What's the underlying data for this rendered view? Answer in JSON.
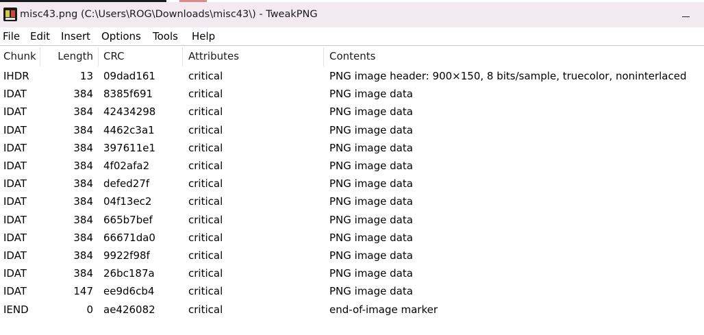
{
  "window": {
    "title": "misc43.png (C:\\Users\\ROG\\Downloads\\misc43\\) - TweakPNG"
  },
  "menu": [
    "File",
    "Edit",
    "Insert",
    "Options",
    "Tools",
    "Help"
  ],
  "columns": [
    "Chunk",
    "Length",
    "CRC",
    "Attributes",
    "Contents"
  ],
  "rows": [
    {
      "chunk": "IHDR",
      "length": "13",
      "crc": "09dad161",
      "attributes": "critical",
      "contents": "PNG image header: 900×150, 8 bits/sample, truecolor, noninterlaced"
    },
    {
      "chunk": "IDAT",
      "length": "384",
      "crc": "8385f691",
      "attributes": "critical",
      "contents": "PNG image data"
    },
    {
      "chunk": "IDAT",
      "length": "384",
      "crc": "42434298",
      "attributes": "critical",
      "contents": "PNG image data"
    },
    {
      "chunk": "IDAT",
      "length": "384",
      "crc": "4462c3a1",
      "attributes": "critical",
      "contents": "PNG image data"
    },
    {
      "chunk": "IDAT",
      "length": "384",
      "crc": "397611e1",
      "attributes": "critical",
      "contents": "PNG image data"
    },
    {
      "chunk": "IDAT",
      "length": "384",
      "crc": "4f02afa2",
      "attributes": "critical",
      "contents": "PNG image data"
    },
    {
      "chunk": "IDAT",
      "length": "384",
      "crc": "defed27f",
      "attributes": "critical",
      "contents": "PNG image data"
    },
    {
      "chunk": "IDAT",
      "length": "384",
      "crc": "04f13ec2",
      "attributes": "critical",
      "contents": "PNG image data"
    },
    {
      "chunk": "IDAT",
      "length": "384",
      "crc": "665b7bef",
      "attributes": "critical",
      "contents": "PNG image data"
    },
    {
      "chunk": "IDAT",
      "length": "384",
      "crc": "66671da0",
      "attributes": "critical",
      "contents": "PNG image data"
    },
    {
      "chunk": "IDAT",
      "length": "384",
      "crc": "9922f98f",
      "attributes": "critical",
      "contents": "PNG image data"
    },
    {
      "chunk": "IDAT",
      "length": "384",
      "crc": "26bc187a",
      "attributes": "critical",
      "contents": "PNG image data"
    },
    {
      "chunk": "IDAT",
      "length": "147",
      "crc": "ee9d6cb4",
      "attributes": "critical",
      "contents": "PNG image data"
    },
    {
      "chunk": "IEND",
      "length": "0",
      "crc": "ae426082",
      "attributes": "critical",
      "contents": "end-of-image marker"
    }
  ],
  "icons": {
    "app": "tweakpng-app-icon",
    "minimize": "minimize-icon"
  },
  "colors": {
    "titlebar_bg": "#f3eaf0",
    "window_bg": "#ffffff"
  }
}
